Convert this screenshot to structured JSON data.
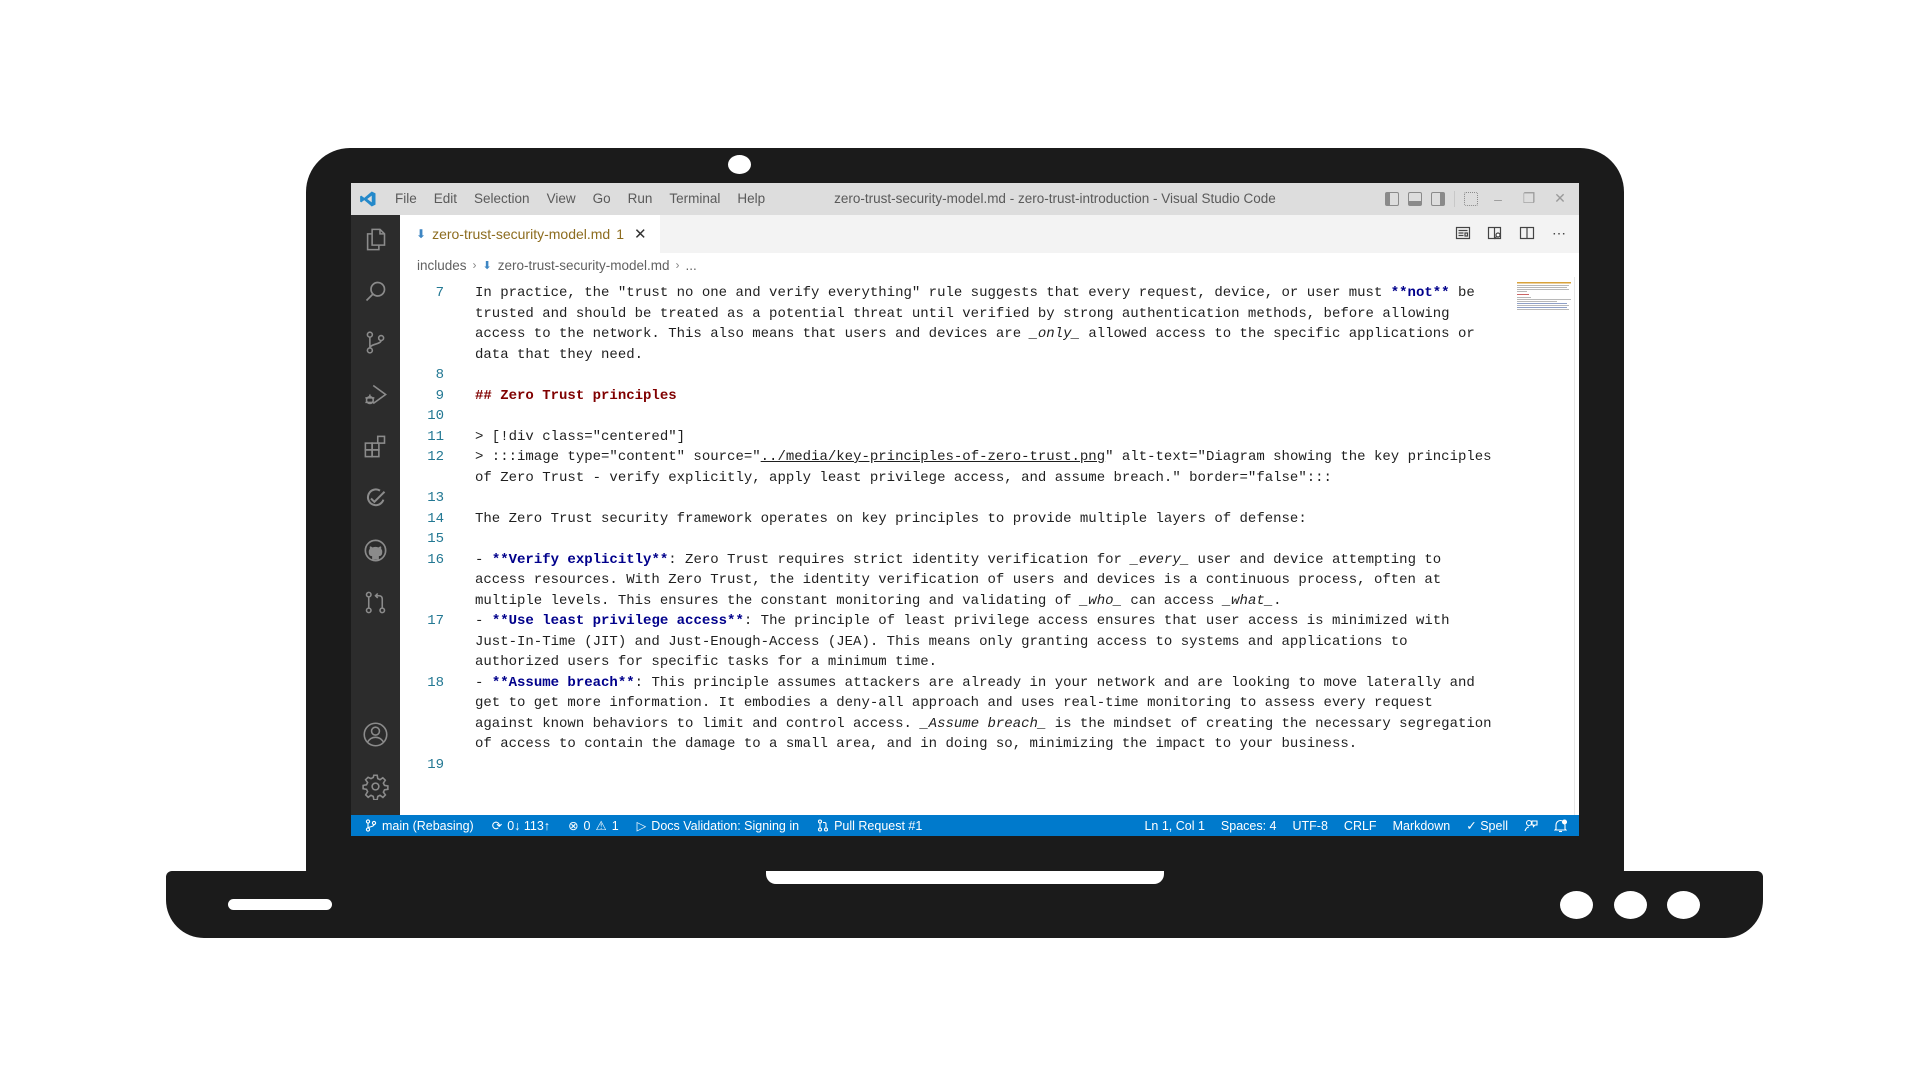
{
  "window": {
    "title": "zero-trust-security-model.md - zero-trust-introduction - Visual Studio Code",
    "menu": [
      "File",
      "Edit",
      "Selection",
      "View",
      "Go",
      "Run",
      "Terminal",
      "Help"
    ],
    "controls": {
      "minimize": "–",
      "restore": "❐",
      "close": "✕"
    }
  },
  "activity_bar": {
    "top_icons": [
      "explorer-icon",
      "search-icon",
      "source-control-icon",
      "run-debug-icon",
      "extensions-icon",
      "testing-icon",
      "github-icon",
      "pull-requests-icon"
    ],
    "bottom_icons": [
      "accounts-icon",
      "manage-gear-icon"
    ]
  },
  "tab": {
    "label": "zero-trust-security-model.md",
    "badge": "1",
    "close": "✕"
  },
  "tab_actions": [
    "open-preview-icon",
    "open-preview-side-icon",
    "split-editor-icon",
    "more-actions-icon"
  ],
  "breadcrumb": {
    "items": [
      "includes",
      "zero-trust-security-model.md",
      "..."
    ]
  },
  "editor": {
    "lines": [
      {
        "n": "7",
        "rows": [
          [
            {
              "t": "In practice, the \"trust no one and verify everything\" rule suggests that every request, device, or user must "
            },
            {
              "t": "**not**",
              "c": "b"
            },
            {
              "t": " be"
            }
          ],
          [
            {
              "t": "trusted and should be treated as a potential threat until verified by strong authentication methods, before allowing"
            }
          ],
          [
            {
              "t": "access to the network. This also means that users and devices are "
            },
            {
              "t": "_only_",
              "c": "it"
            },
            {
              "t": " allowed access to the specific applications or"
            }
          ],
          [
            {
              "t": "data that they need."
            }
          ]
        ]
      },
      {
        "n": "8",
        "rows": [
          [
            {
              "t": ""
            }
          ]
        ]
      },
      {
        "n": "9",
        "rows": [
          [
            {
              "t": "## Zero Trust principles",
              "c": "hdr"
            }
          ]
        ]
      },
      {
        "n": "10",
        "rows": [
          [
            {
              "t": ""
            }
          ]
        ]
      },
      {
        "n": "11",
        "rows": [
          [
            {
              "t": "> [!div class=\"centered\"]"
            }
          ]
        ]
      },
      {
        "n": "12",
        "rows": [
          [
            {
              "t": "> :::image type=\"content\" source=\""
            },
            {
              "t": "../media/key-principles-of-zero-trust.png",
              "c": "ul"
            },
            {
              "t": "\" alt-text=\"Diagram showing the key principles"
            }
          ],
          [
            {
              "t": "of Zero Trust - verify explicitly, apply least privilege access, and assume breach.\" border=\"false\":::"
            }
          ]
        ]
      },
      {
        "n": "13",
        "rows": [
          [
            {
              "t": ""
            }
          ]
        ]
      },
      {
        "n": "14",
        "rows": [
          [
            {
              "t": "The Zero Trust security framework operates on key principles to provide multiple layers of defense:"
            }
          ]
        ]
      },
      {
        "n": "15",
        "rows": [
          [
            {
              "t": ""
            }
          ]
        ]
      },
      {
        "n": "16",
        "rows": [
          [
            {
              "t": "- "
            },
            {
              "t": "**Verify explicitly**",
              "c": "b"
            },
            {
              "t": ": Zero Trust requires strict identity verification for "
            },
            {
              "t": "_every_",
              "c": "it"
            },
            {
              "t": " user and device attempting to"
            }
          ],
          [
            {
              "t": "access resources. With Zero Trust, the identity verification of users and devices is a continuous process, often at"
            }
          ],
          [
            {
              "t": "multiple levels. This ensures the constant monitoring and validating of "
            },
            {
              "t": "_who_",
              "c": "it"
            },
            {
              "t": " can access "
            },
            {
              "t": "_what_",
              "c": "it"
            },
            {
              "t": "."
            }
          ]
        ]
      },
      {
        "n": "17",
        "rows": [
          [
            {
              "t": "- "
            },
            {
              "t": "**Use least privilege access**",
              "c": "b"
            },
            {
              "t": ": The principle of least privilege access ensures that user access is minimized with"
            }
          ],
          [
            {
              "t": "Just-In-Time (JIT) and Just-Enough-Access (JEA). This means only granting access to systems and applications to"
            }
          ],
          [
            {
              "t": "authorized users for specific tasks for a minimum time."
            }
          ]
        ]
      },
      {
        "n": "18",
        "rows": [
          [
            {
              "t": "- "
            },
            {
              "t": "**Assume breach**",
              "c": "b"
            },
            {
              "t": ": This principle assumes attackers are already in your network and are looking to move laterally and"
            }
          ],
          [
            {
              "t": "get to get more information. It embodies a deny-all approach and uses real-time monitoring to assess every request"
            }
          ],
          [
            {
              "t": "against known behaviors to limit and control access. "
            },
            {
              "t": "_Assume breach_",
              "c": "it"
            },
            {
              "t": " is the mindset of creating the necessary segregation"
            }
          ],
          [
            {
              "t": "of access to contain the damage to a small area, and in doing so, minimizing the impact to your business."
            }
          ]
        ]
      },
      {
        "n": "19",
        "rows": [
          [
            {
              "t": ""
            }
          ]
        ]
      }
    ]
  },
  "status_bar": {
    "branch": "main (Rebasing)",
    "sync": "0↓ 113↑",
    "errors": "0",
    "warnings": "1",
    "docs_validation": "Docs Validation: Signing in",
    "pull_request": "Pull Request #1",
    "cursor": "Ln 1, Col 1",
    "spaces": "Spaces: 4",
    "encoding": "UTF-8",
    "eol": "CRLF",
    "language": "Markdown",
    "spell": "✓ Spell"
  },
  "colors": {
    "status_bar": "#007acc",
    "activity_bar": "#2c2c2c",
    "title_bar": "#dddddd",
    "line_number": "#237893",
    "bold_markdown": "#00008b",
    "heading_markdown": "#800000",
    "tab_label_modified": "#8d6c1f",
    "laptop_frame": "#1b1b1b"
  }
}
